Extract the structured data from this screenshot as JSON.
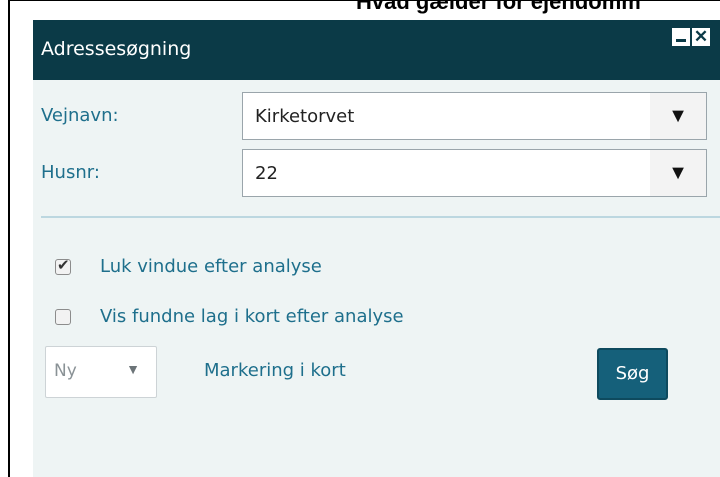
{
  "page": {
    "heading": "Hvad gælder for ejendomm"
  },
  "panel": {
    "title": "Adressesøgning",
    "controls": {
      "minimize_icon": "minimize-icon",
      "close_icon": "close-icon",
      "close_glyph": "✕"
    }
  },
  "form": {
    "street": {
      "label": "Vejnavn:",
      "value": "Kirketorvet",
      "dropdown_glyph": "▼"
    },
    "house_number": {
      "label": "Husnr:",
      "value": "22",
      "dropdown_glyph": "▼"
    }
  },
  "options": {
    "close_after_analysis": {
      "label": "Luk vindue efter analyse",
      "checked": true,
      "tick": "✔"
    },
    "show_layers": {
      "label": "Vis fundne lag i kort efter analyse",
      "checked": false
    }
  },
  "marking": {
    "select_value": "Ny",
    "select_arrow": "▼",
    "label": "Markering i kort"
  },
  "actions": {
    "search_label": "Søg"
  },
  "colors": {
    "header_bg": "#0b3a47",
    "label_blue": "#1e6f8c",
    "button_bg": "#15607a",
    "panel_bg": "#eef4f4"
  }
}
